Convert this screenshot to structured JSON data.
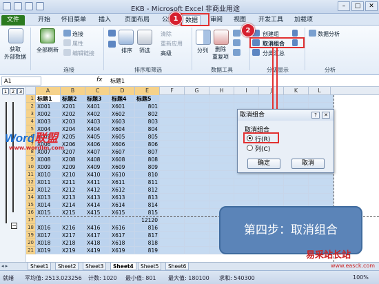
{
  "window": {
    "title": "EKB - Microsoft Excel 非商业用途",
    "minimize": "–",
    "maximize": "□",
    "close": "✕"
  },
  "tabs": [
    "文件",
    "开始",
    "怀旧菜单",
    "插入",
    "页面布局",
    "公式",
    "数据",
    "审阅",
    "视图",
    "开发工具",
    "加载项"
  ],
  "ribbon": {
    "get_external": "获取\n外部数据",
    "refresh_all": "全部刷新",
    "connections": "连接",
    "properties": "属性",
    "edit_links": "编辑链接",
    "sort": "排序",
    "filter": "筛选",
    "clear": "清除",
    "reapply": "重新应用",
    "advanced": "高级",
    "text_to_columns": "分列",
    "remove_duplicates": "删除\n重复项",
    "group": "创建组",
    "ungroup": "取消组合",
    "subtotal": "分类汇总",
    "data_analysis": "数据分析",
    "groups": {
      "connections": "连接",
      "sort_filter": "排序和筛选",
      "data_tools": "数据工具",
      "outline": "分级显示",
      "analysis": "分析"
    }
  },
  "formula_bar": {
    "name_box": "A1",
    "fx": "fx",
    "value": "标题1"
  },
  "outline_levels": [
    "1",
    "2",
    "3"
  ],
  "columns": [
    "A",
    "B",
    "C",
    "D",
    "E",
    "F",
    "G",
    "H",
    "I",
    "J",
    "K",
    "L"
  ],
  "header_row": [
    "标题1",
    "标题2",
    "标题3",
    "标题4",
    "标题5"
  ],
  "rows": [
    {
      "n": "1",
      "cells": [
        "标题1",
        "标题2",
        "标题3",
        "标题4",
        "标题5"
      ]
    },
    {
      "n": "2",
      "cells": [
        "X001",
        "X201",
        "X401",
        "X601",
        "801"
      ]
    },
    {
      "n": "3",
      "cells": [
        "X002",
        "X202",
        "X402",
        "X602",
        "802"
      ]
    },
    {
      "n": "4",
      "cells": [
        "X003",
        "X203",
        "X403",
        "X603",
        "803"
      ]
    },
    {
      "n": "5",
      "cells": [
        "X004",
        "X204",
        "X404",
        "X604",
        "804"
      ]
    },
    {
      "n": "6",
      "cells": [
        "X005",
        "X205",
        "X405",
        "X605",
        "805"
      ]
    },
    {
      "n": "7",
      "cells": [
        "X006",
        "X206",
        "X406",
        "X606",
        "806"
      ]
    },
    {
      "n": "8",
      "cells": [
        "X007",
        "X207",
        "X407",
        "X607",
        "807"
      ]
    },
    {
      "n": "9",
      "cells": [
        "X008",
        "X208",
        "X408",
        "X608",
        "808"
      ]
    },
    {
      "n": "10",
      "cells": [
        "X009",
        "X209",
        "X409",
        "X609",
        "809"
      ]
    },
    {
      "n": "11",
      "cells": [
        "X010",
        "X210",
        "X410",
        "X610",
        "810"
      ]
    },
    {
      "n": "12",
      "cells": [
        "X011",
        "X211",
        "X411",
        "X611",
        "811"
      ]
    },
    {
      "n": "13",
      "cells": [
        "X012",
        "X212",
        "X412",
        "X612",
        "812"
      ]
    },
    {
      "n": "14",
      "cells": [
        "X013",
        "X213",
        "X413",
        "X613",
        "813"
      ]
    },
    {
      "n": "15",
      "cells": [
        "X014",
        "X214",
        "X414",
        "X614",
        "814"
      ]
    },
    {
      "n": "16",
      "cells": [
        "X015",
        "X215",
        "X415",
        "X615",
        "815"
      ]
    },
    {
      "n": "17",
      "cells": [
        "",
        "",
        "",
        "",
        "12120"
      ]
    },
    {
      "n": "18",
      "cells": [
        "X016",
        "X216",
        "X416",
        "X616",
        "816"
      ]
    },
    {
      "n": "19",
      "cells": [
        "X017",
        "X217",
        "X417",
        "X617",
        "817"
      ]
    },
    {
      "n": "20",
      "cells": [
        "X018",
        "X218",
        "X418",
        "X618",
        "818"
      ]
    },
    {
      "n": "21",
      "cells": [
        "X019",
        "X219",
        "X419",
        "X619",
        "819"
      ]
    }
  ],
  "sheet_tabs": [
    "Sheet1",
    "Sheet2",
    "Sheet3",
    "Sheet4",
    "Sheet5",
    "Sheet6"
  ],
  "active_sheet": "Sheet4",
  "status": {
    "ready": "就绪",
    "average": "平均值: 2513.023256",
    "count": "计数: 1020",
    "min": "最小值: 801",
    "max": "最大值: 180100",
    "sum": "求和: 540300",
    "zoom": "100%"
  },
  "dialog": {
    "title": "取消组合",
    "help": "?",
    "close": "✕",
    "group_label": "取消组合",
    "option_row": "行(R)",
    "option_col": "列(C)",
    "ok": "确定",
    "cancel": "取消"
  },
  "annotations": {
    "step1": "1",
    "step2": "2",
    "callout": "第四步：取消组合"
  },
  "watermarks": {
    "logo_word": "Word",
    "logo_cn": "联盟",
    "logo_url": "www.wordlm.com",
    "site": "易采站长站",
    "site_url": "www.easck.com"
  },
  "colors": {
    "file_tab": "#2b7a1f",
    "selection": "#bcd3ee",
    "highlight": "#e23030",
    "callout": "#5b84b8"
  }
}
